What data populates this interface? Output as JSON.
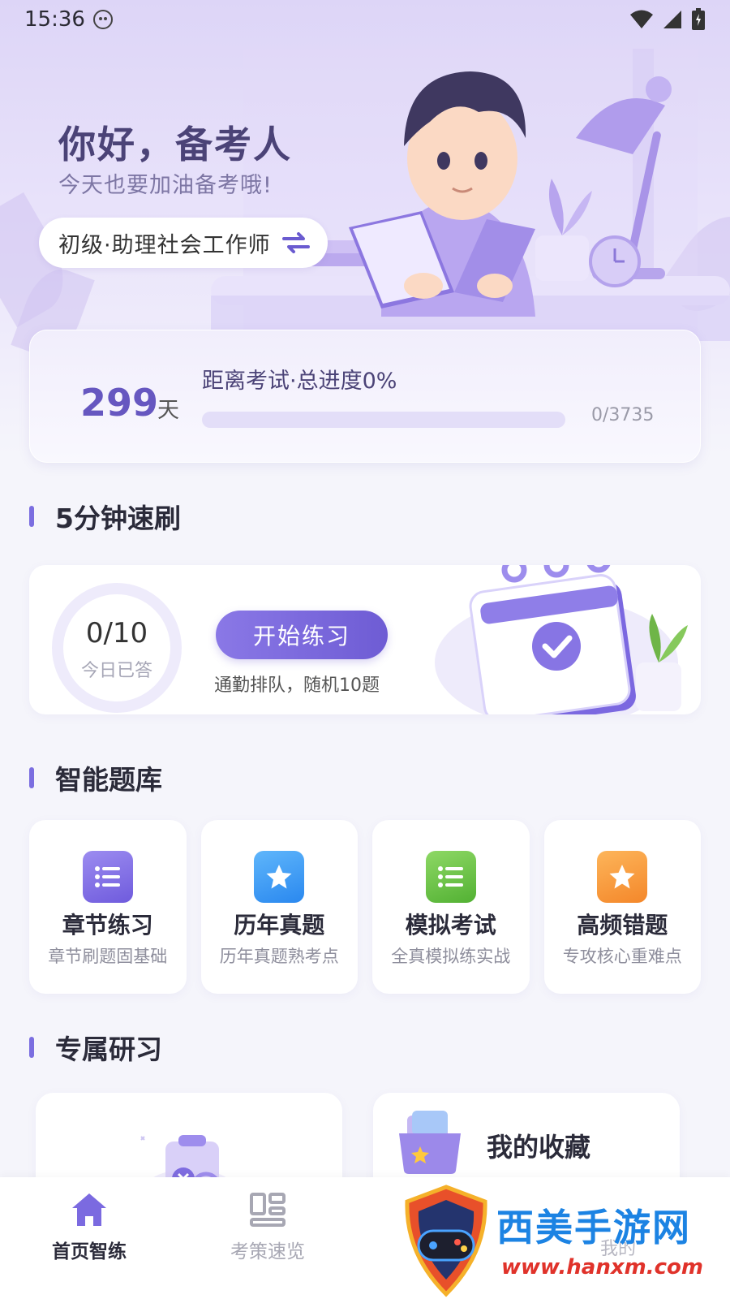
{
  "status_bar": {
    "time": "15:36"
  },
  "hero": {
    "greeting": "你好，备考人",
    "subtitle": "今天也要加油备考哦!",
    "level": "初级·助理社会工作师"
  },
  "countdown": {
    "days": "299",
    "days_unit": "天",
    "progress_label": "距离考试·总进度0%",
    "progress_fraction": 0,
    "progress_count": "0/3735"
  },
  "quick_practice": {
    "section_title": "5分钟速刷",
    "answered_value": "0/10",
    "answered_label": "今日已答",
    "start_button": "开始练习",
    "description": "通勤排队，随机10题"
  },
  "question_bank": {
    "section_title": "智能题库",
    "items": [
      {
        "title": "章节练习",
        "subtitle": "章节刷题固基础",
        "icon": "list-icon",
        "color": "#7d69e6"
      },
      {
        "title": "历年真题",
        "subtitle": "历年真题熟考点",
        "icon": "star-icon",
        "color": "#3b9ef5"
      },
      {
        "title": "模拟考试",
        "subtitle": "全真模拟练实战",
        "icon": "list-icon",
        "color": "#66c24a"
      },
      {
        "title": "高频错题",
        "subtitle": "专攻核心重难点",
        "icon": "star-icon",
        "color": "#f79c36"
      }
    ]
  },
  "exclusive_study": {
    "section_title": "专属研习",
    "favorites_label": "我的收藏"
  },
  "bottom_nav": {
    "items": [
      {
        "label": "首页智练",
        "icon": "home-icon",
        "active": true
      },
      {
        "label": "考策速览",
        "icon": "grid-icon",
        "active": false
      },
      {
        "label": "我的",
        "icon": "profile-icon",
        "active": false
      }
    ]
  },
  "watermark": {
    "title": "西美手游网",
    "url": "www.hanxm.com"
  }
}
